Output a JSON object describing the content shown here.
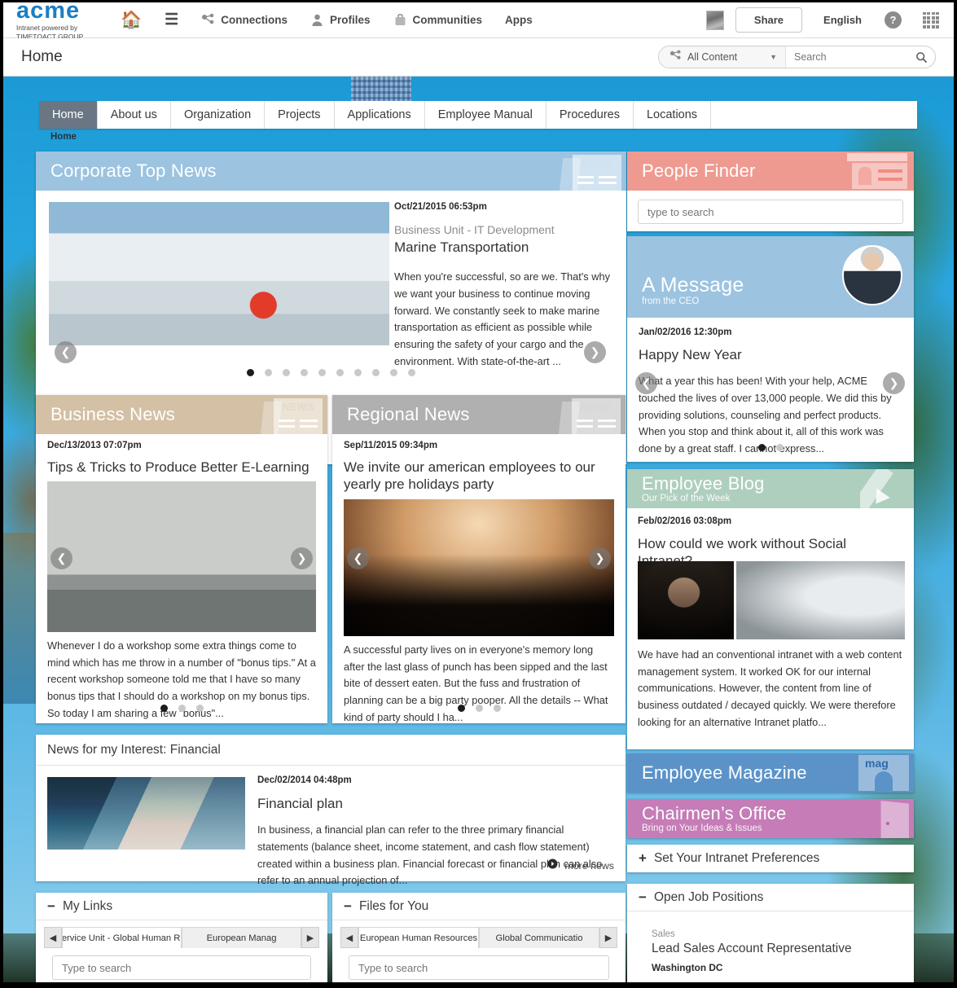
{
  "header": {
    "logo_word": "acme",
    "logo_sub_1": "Intranet powered by",
    "logo_sub_2": "TIMETOACT GROUP",
    "nav": [
      {
        "label": "",
        "icon": "home-icon"
      },
      {
        "label": "",
        "icon": "hamburger-icon"
      },
      {
        "label": "Connections",
        "icon": "connections-icon"
      },
      {
        "label": "Profiles",
        "icon": "profile-icon"
      },
      {
        "label": "Communities",
        "icon": "communities-icon"
      },
      {
        "label": "Apps",
        "icon": ""
      }
    ],
    "share_label": "Share",
    "language_label": "English",
    "help_label": "?"
  },
  "titlebar": {
    "page_title": "Home",
    "search_scope": "All Content",
    "search_placeholder": "Search"
  },
  "main_nav": {
    "tabs": [
      "Home",
      "About us",
      "Organization",
      "Projects",
      "Applications",
      "Employee Manual",
      "Procedures",
      "Locations"
    ],
    "active": "Home",
    "breadcrumb": "Home"
  },
  "corporate_top_news": {
    "title": "Corporate Top News",
    "deco_label": "NEWS",
    "accent": "#9cc3e0",
    "item": {
      "date": "Oct/21/2015 06:53pm",
      "source": "Business Unit - IT Development",
      "headline": "Marine Transportation",
      "body": "When you're successful, so are we. That's why we want your business to continue moving forward. We constantly seek to make marine transportation as efficient as possible while ensuring the safety of your cargo and the environment. With state-of-the-art ..."
    },
    "dots_total": 10,
    "dots_active": 1
  },
  "business_news": {
    "title": "Business News",
    "deco_label": "NEWS",
    "accent": "#d3c0a5",
    "item": {
      "date": "Dec/13/2013 07:07pm",
      "headline": "Tips & Tricks to Produce Better E-Learning",
      "body": "Whenever I do a workshop some extra things come to mind which has me throw in a number of \"bonus tips.\" At a recent workshop someone told me that I have so many bonus tips that I should do a workshop on my bonus tips. So today I am sharing a few \"bonus\"..."
    },
    "dots_total": 3,
    "dots_active": 1
  },
  "regional_news": {
    "title": "Regional News",
    "deco_label": "NEWS",
    "accent": "#b0b0b0",
    "item": {
      "date": "Sep/11/2015 09:34pm",
      "headline": "We invite our american employees to our yearly pre holidays party",
      "body": "A successful party lives on in everyone's memory long after the last glass of punch has been sipped and the last bite of dessert eaten. But the fuss and frustration of planning can be a big party pooper. All the details -- What kind of party should I ha..."
    },
    "dots_total": 3,
    "dots_active": 1
  },
  "news_interest": {
    "title": "News for my Interest: Financial",
    "item": {
      "date": "Dec/02/2014 04:48pm",
      "headline": "Financial plan",
      "body": "In business, a financial plan can refer to the three primary financial statements (balance sheet, income statement, and cash flow statement) created within a business plan. Financial forecast or financial plan can also refer to an annual projection of..."
    },
    "more_label": "more news"
  },
  "my_links": {
    "title": "My Links",
    "toggle_sign": "−",
    "tabs": [
      "Service Unit - Global Human R...",
      "European Manag"
    ],
    "active_tab": "Service Unit - Global Human R...",
    "search_placeholder": "Type to search"
  },
  "files_for_you": {
    "title": "Files for You",
    "toggle_sign": "−",
    "tabs": [
      "European Human Resources",
      "Global Communicatio"
    ],
    "active_tab": "European Human Resources",
    "search_placeholder": "Type to search"
  },
  "people_finder": {
    "title": "People Finder",
    "accent": "#ef9a91",
    "search_placeholder": "type to search"
  },
  "ceo_message": {
    "title": "A Message",
    "subtitle": "from the CEO",
    "accent": "#9cc3e0",
    "item": {
      "date": "Jan/02/2016 12:30pm",
      "headline": "Happy New Year",
      "body": "What a year this has been! With your help, ACME touched the lives of over 13,000 people. We did this by providing solutions, counseling and perfect products. When you stop and think about it, all of this work was done by a great staff. I cannot express..."
    },
    "dots_total": 2,
    "dots_active": 1
  },
  "employee_blog": {
    "title": "Employee Blog",
    "subtitle": "Our Pick of the Week",
    "accent": "#aecfbd",
    "item": {
      "date": "Feb/02/2016 03:08pm",
      "headline": "How could we work without Social Intranet?",
      "body": "We have had an conventional intranet with a web content management system. It worked OK for our internal communications. However, the content from line of business outdated / decayed quickly. We were therefore looking for an alternative Intranet platfo..."
    }
  },
  "employee_magazine": {
    "title": "Employee Magazine",
    "accent": "#5b93c9",
    "deco_label": "mag"
  },
  "chairmens_office": {
    "title": "Chairmen’s Office",
    "subtitle": "Bring on Your Ideas & Issues",
    "accent": "#c57cb7"
  },
  "intranet_prefs": {
    "title": "Set Your Intranet Preferences",
    "toggle_sign": "+"
  },
  "open_jobs": {
    "title": "Open Job Positions",
    "toggle_sign": "−",
    "items": [
      {
        "dept": "Sales",
        "role": "Lead Sales Account Representative",
        "location": "Washington DC"
      }
    ]
  }
}
